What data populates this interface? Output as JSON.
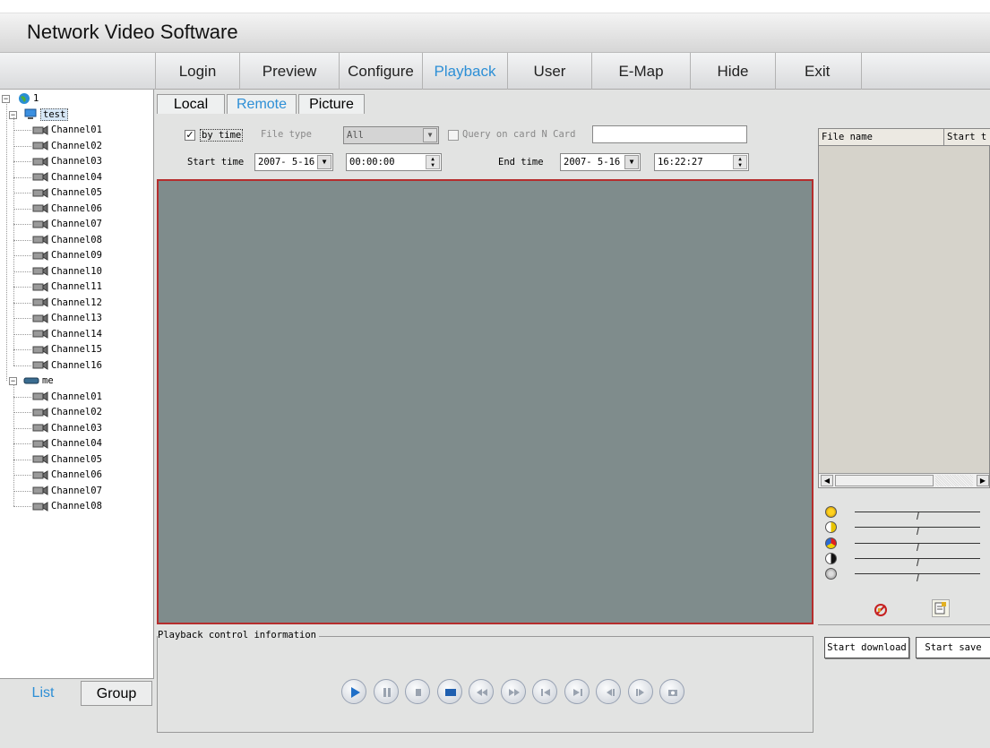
{
  "app": {
    "title": "Network Video Software"
  },
  "menu": {
    "items": [
      {
        "label": "Login"
      },
      {
        "label": "Preview"
      },
      {
        "label": "Configure"
      },
      {
        "label": "Playback"
      },
      {
        "label": "User"
      },
      {
        "label": "E-Map"
      },
      {
        "label": "Hide"
      },
      {
        "label": "Exit"
      }
    ],
    "active": "Playback"
  },
  "tree": {
    "root": "1",
    "groups": [
      {
        "name": "test",
        "channels": [
          "Channel01",
          "Channel02",
          "Channel03",
          "Channel04",
          "Channel05",
          "Channel06",
          "Channel07",
          "Channel08",
          "Channel09",
          "Channel10",
          "Channel11",
          "Channel12",
          "Channel13",
          "Channel14",
          "Channel15",
          "Channel16"
        ]
      },
      {
        "name": "me",
        "channels": [
          "Channel01",
          "Channel02",
          "Channel03",
          "Channel04",
          "Channel05",
          "Channel06",
          "Channel07",
          "Channel08"
        ]
      }
    ]
  },
  "left_tabs": {
    "list": "List",
    "group": "Group"
  },
  "content_tabs": [
    {
      "label": "Local"
    },
    {
      "label": "Remote"
    },
    {
      "label": "Picture"
    }
  ],
  "query": {
    "by_time_label": "by time",
    "by_time_checked": true,
    "file_type_label": "File type",
    "file_type_value": "All",
    "query_card_label": "Query on card N Card",
    "query_card_checked": false,
    "card_value": "",
    "start_time_label": "Start time",
    "start_date": "2007- 5-16",
    "start_time": "00:00:00",
    "end_time_label": "End time",
    "end_date": "2007- 5-16",
    "end_time": "16:22:27"
  },
  "file_list": {
    "columns": [
      "File name",
      "Start t"
    ]
  },
  "playback": {
    "group_title": "Playback control information",
    "controls": [
      "play-icon",
      "pause-icon",
      "stop-icon",
      "stop-all-icon",
      "rewind-icon",
      "fast-forward-icon",
      "previous-icon",
      "next-icon",
      "step-back-icon",
      "step-forward-icon",
      "snapshot-icon"
    ]
  },
  "image_adjust": {
    "sliders": [
      {
        "name": "brightness",
        "value": 0.5
      },
      {
        "name": "contrast",
        "value": 0.5
      },
      {
        "name": "saturation",
        "value": 0.5
      },
      {
        "name": "hue",
        "value": 0.5
      },
      {
        "name": "volume",
        "value": 0.5
      }
    ]
  },
  "buttons": {
    "start_download": "Start download",
    "start_save": "Start save"
  },
  "colors": {
    "accent": "#2d8fd6",
    "video_bg": "#7f8c8c",
    "video_border": "#b52d2d"
  }
}
